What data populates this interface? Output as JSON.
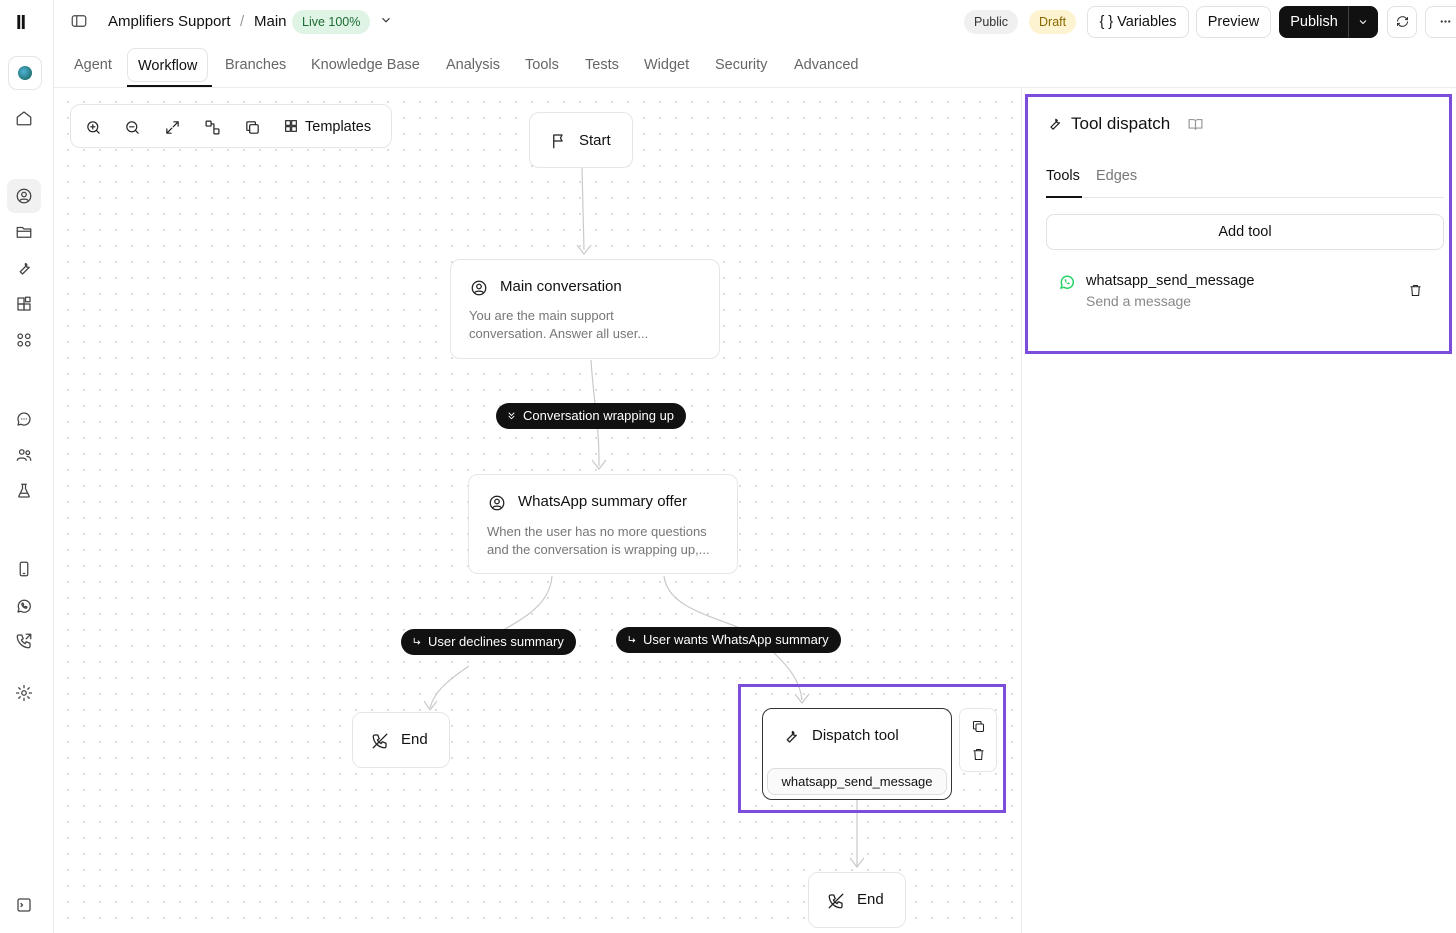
{
  "app": {
    "logo": "II"
  },
  "header": {
    "agent_name": "Amplifiers Support",
    "separator": "/",
    "branch": "Main",
    "live_badge": "Live 100%",
    "public_badge": "Public",
    "draft_badge": "Draft",
    "variables_label": "{ } Variables",
    "preview_label": "Preview",
    "publish_label": "Publish"
  },
  "tabs": [
    {
      "label": "Agent"
    },
    {
      "label": "Workflow",
      "active": true
    },
    {
      "label": "Branches"
    },
    {
      "label": "Knowledge Base"
    },
    {
      "label": "Analysis"
    },
    {
      "label": "Tools"
    },
    {
      "label": "Tests"
    },
    {
      "label": "Widget"
    },
    {
      "label": "Security"
    },
    {
      "label": "Advanced"
    }
  ],
  "toolbar": {
    "templates_label": "Templates"
  },
  "nodes": {
    "start": {
      "title": "Start"
    },
    "main": {
      "title": "Main conversation",
      "desc": "You are the main support conversation. Answer all user..."
    },
    "whatsapp": {
      "title": "WhatsApp summary offer",
      "desc": "When the user has no more questions and the conversation is wrapping up,..."
    },
    "end_left": {
      "title": "End"
    },
    "dispatch": {
      "title": "Dispatch tool",
      "tool": "whatsapp_send_message"
    },
    "end_bottom": {
      "title": "End"
    }
  },
  "edge_labels": {
    "wrapping": "Conversation wrapping up",
    "declines": "User declines summary",
    "wants": "User wants WhatsApp summary"
  },
  "panel": {
    "title": "Tool dispatch",
    "tabs": [
      "Tools",
      "Edges"
    ],
    "add_tool_label": "Add tool",
    "tools": [
      {
        "name": "whatsapp_send_message",
        "description": "Send a message",
        "icon": "whatsapp-icon"
      }
    ]
  },
  "colors": {
    "selection": "#7c4ddb",
    "live_bg": "#dff4e4",
    "draft_bg": "#fdf3d0",
    "whatsapp": "#25d366"
  }
}
